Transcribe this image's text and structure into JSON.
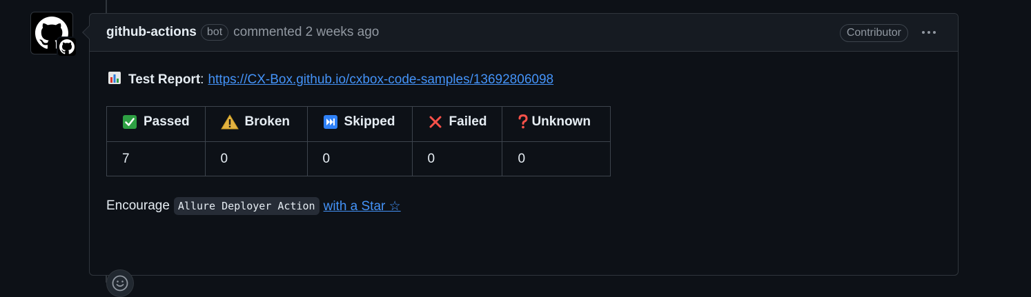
{
  "comment": {
    "author": "github-actions",
    "author_badge": "bot",
    "action": "commented 2 weeks ago",
    "role_badge": "Contributor",
    "menu_icon": "kebab-horizontal-icon",
    "avatar_icon": "github-octocat-icon"
  },
  "report": {
    "icon": "bar-chart-emoji",
    "label": "Test Report",
    "separator": ":",
    "link_text": "https://CX-Box.github.io/cxbox-code-samples/13692806098"
  },
  "results_table": {
    "headers": [
      {
        "icon": "check-mark-button-emoji",
        "label": "Passed"
      },
      {
        "icon": "warning-emoji",
        "label": "Broken"
      },
      {
        "icon": "next-track-emoji",
        "label": "Skipped"
      },
      {
        "icon": "cross-mark-emoji",
        "label": "Failed"
      },
      {
        "icon": "question-mark-emoji",
        "label": "Unknown"
      }
    ],
    "values": [
      "7",
      "0",
      "0",
      "0",
      "0"
    ]
  },
  "encourage": {
    "prefix": "Encourage",
    "code": "Allure Deployer Action",
    "link_text": "with a Star ☆"
  },
  "reactions": {
    "add_icon": "smiley-icon"
  },
  "colors": {
    "background": "#0d1117",
    "header_bg": "#161b22",
    "border": "#30363d",
    "link": "#4493f8",
    "muted": "#9198a1",
    "passed_green": "#2ea043",
    "warning_yellow": "#e3b341",
    "failed_red": "#f85149",
    "skipped_blue": "#2f81f7"
  }
}
